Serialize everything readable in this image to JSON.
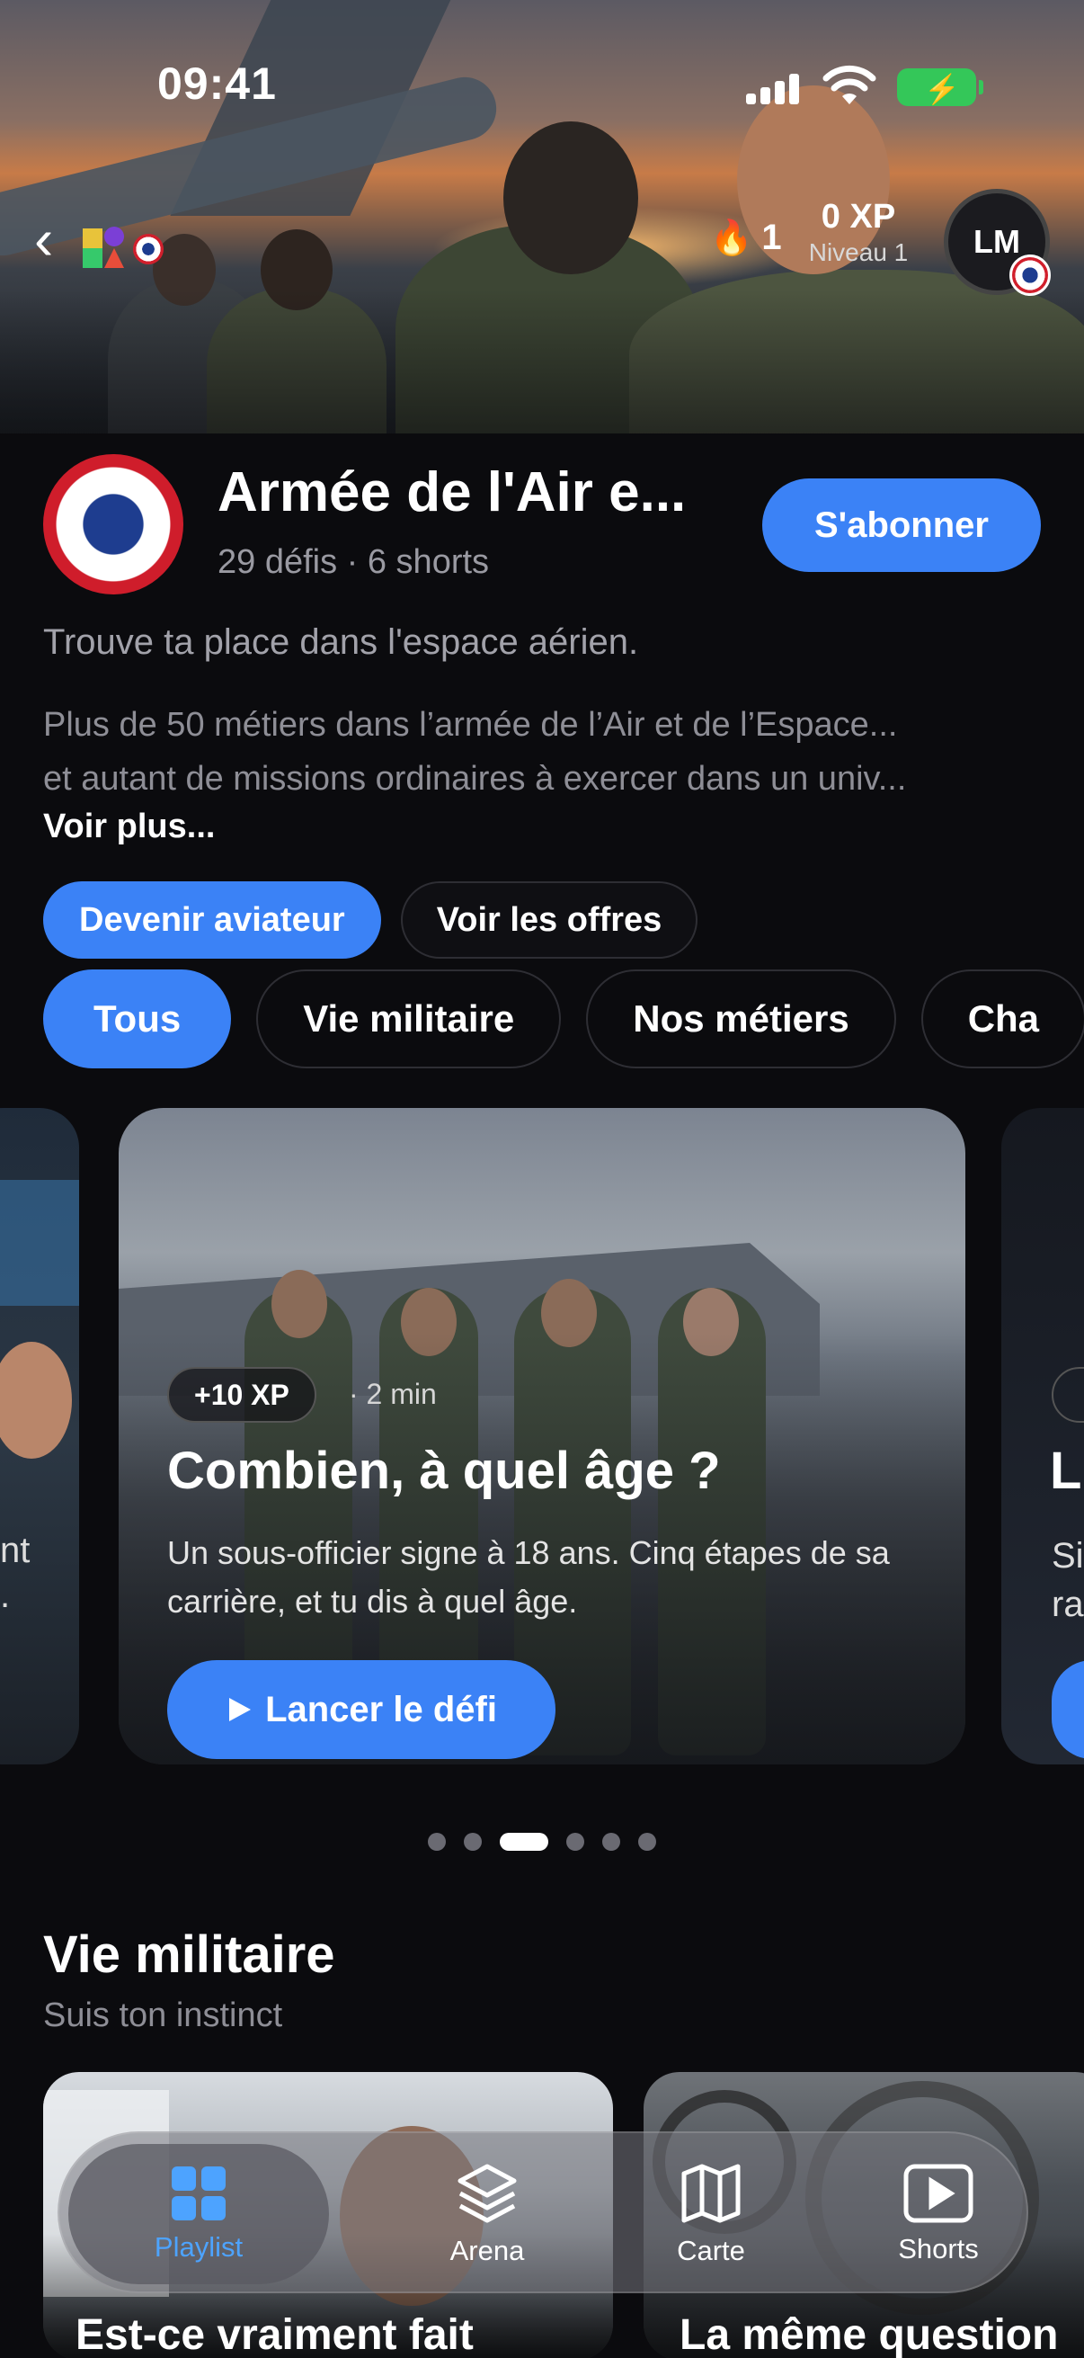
{
  "status_bar": {
    "time": "09:41"
  },
  "header": {
    "streak": "1",
    "xp": "0 XP",
    "level": "Niveau 1",
    "avatar_initials": "LM"
  },
  "channel": {
    "name": "Armée de l'Air e...",
    "meta": "29 défis · 6 shorts",
    "subscribe_label": "S'abonner",
    "tagline": "Trouve ta place dans l'espace aérien.",
    "description_lines": [
      "Plus de 50 métiers dans l’armée de l’Air et de l’Espace...",
      "et autant de missions ordinaires à exercer dans un univ..."
    ],
    "see_more": "Voir plus...",
    "cta": [
      "Devenir aviateur",
      "Voir les offres"
    ]
  },
  "filters": [
    "Tous",
    "Vie militaire",
    "Nos métiers",
    "Cha"
  ],
  "carousel": {
    "left_peek": [
      "nt",
      "."
    ],
    "main": {
      "xp_badge": "+10 XP",
      "duration": "· 2 min",
      "title": "Combien, à quel âge ?",
      "description": "Un sous-officier signe à 18 ans. Cinq étapes de sa carrière, et tu dis à quel âge.",
      "launch_label": "Lancer le défi"
    },
    "right_peek": [
      "L",
      "Si",
      "ra"
    ],
    "page_count": 6,
    "active_page": 2
  },
  "section": {
    "title": "Vie militaire",
    "subtitle": "Suis ton instinct",
    "thumbs": [
      "Est-ce vraiment fait",
      "La même question"
    ]
  },
  "tabbar": {
    "items": [
      {
        "label": "Playlist",
        "icon": "playlist-grid-icon",
        "selected": true
      },
      {
        "label": "Arena",
        "icon": "layers-icon",
        "selected": false
      },
      {
        "label": "Carte",
        "icon": "map-icon",
        "selected": false
      },
      {
        "label": "Shorts",
        "icon": "play-square-icon",
        "selected": false
      }
    ]
  },
  "colors": {
    "accent": "#3b82f6",
    "background": "#0b0b0e",
    "selected_tab": "#4da3ff"
  }
}
